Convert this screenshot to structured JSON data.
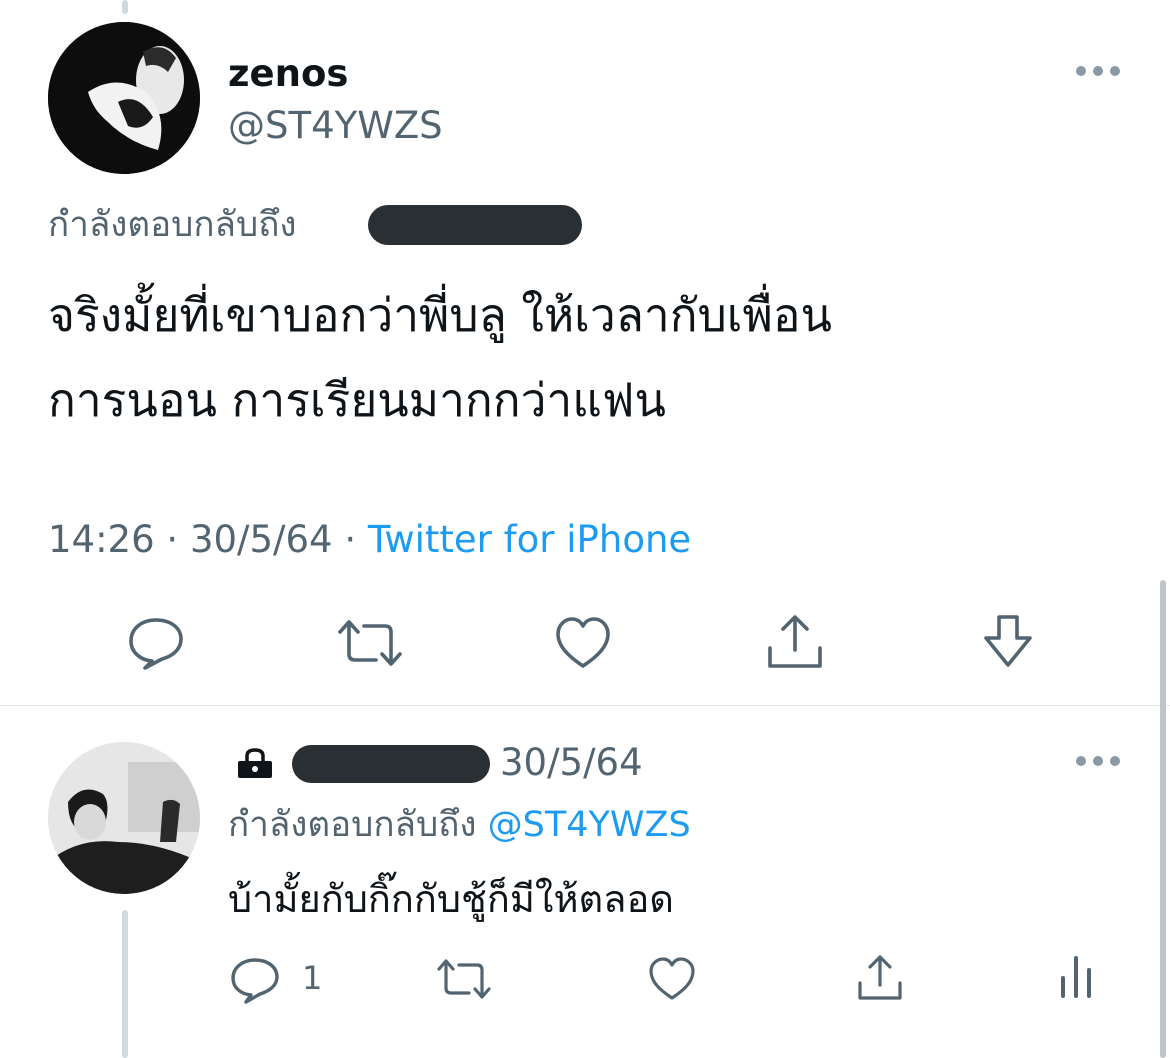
{
  "main_tweet": {
    "display_name": "zenos",
    "handle": "@ST4YWZS",
    "replying_to_label": "กำลังตอบกลับถึง",
    "text_line1": "จริงมั้ยที่เขาบอกว่าพี่บลู ให้เวลากับเพื่อน",
    "text_line2": "การนอน การเรียนมากกว่าแฟน",
    "time": "14:26",
    "sep1": "·",
    "date": "30/5/64",
    "sep2": "·",
    "source": "Twitter for iPhone"
  },
  "action_icons": [
    "reply-icon",
    "retweet-icon",
    "like-icon",
    "share-icon",
    "download-icon"
  ],
  "reply_tweet": {
    "date": "30/5/64",
    "replying_to_label": "กำลังตอบกลับถึง",
    "replying_to_handle": "@ST4YWZS",
    "text": "บ้ามั้ยกับกิ๊กกับชู้ก็มีให้ตลอด",
    "reply_count": "1"
  },
  "colors": {
    "text": "#0f1419",
    "muted": "#536471",
    "link": "#1d9bf0",
    "icon": "#536471"
  }
}
